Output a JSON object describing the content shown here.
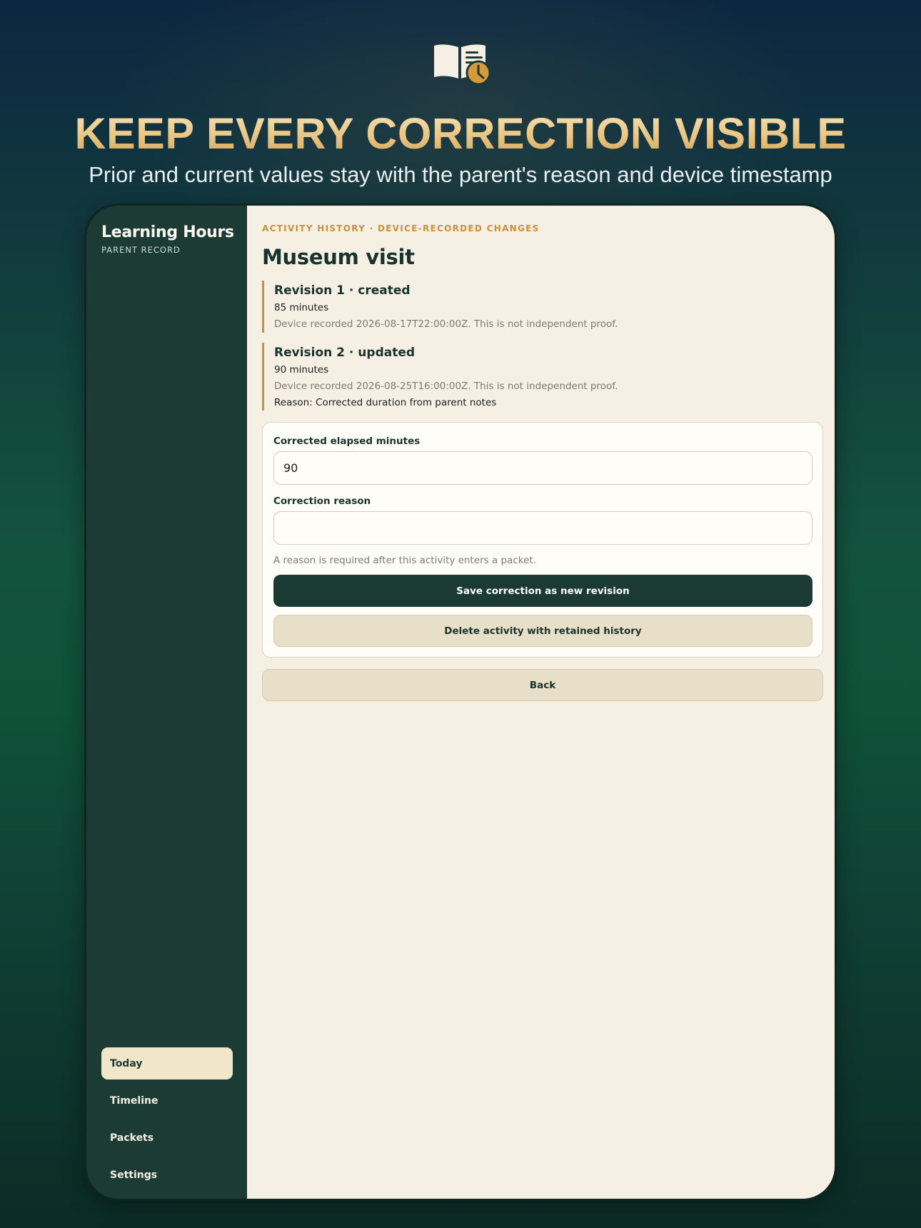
{
  "hero": {
    "icon": "book-clock-icon",
    "headline": "KEEP EVERY CORRECTION VISIBLE",
    "subhead": "Prior and current values stay with the parent's reason and device timestamp"
  },
  "colors": {
    "accent_gold": "#c9913a",
    "sidebar_bg": "#1b3b34",
    "main_bg": "#f6f0e4",
    "primary_button": "#1b3a34",
    "secondary_button": "#e8dfc8",
    "active_nav": "#f1e6ca"
  },
  "sidebar": {
    "title": "Learning Hours",
    "subtitle": "PARENT RECORD",
    "nav": [
      {
        "label": "Today",
        "active": true
      },
      {
        "label": "Timeline",
        "active": false
      },
      {
        "label": "Packets",
        "active": false
      },
      {
        "label": "Settings",
        "active": false
      }
    ]
  },
  "main": {
    "kicker": "ACTIVITY HISTORY · DEVICE-RECORDED CHANGES",
    "title": "Museum visit",
    "revisions": [
      {
        "title": "Revision 1 · created",
        "value": "85 minutes",
        "note": "Device recorded 2026-08-17T22:00:00Z. This is not independent proof."
      },
      {
        "title": "Revision 2 · updated",
        "value": "90 minutes",
        "note": "Device recorded 2026-08-25T16:00:00Z. This is not independent proof.",
        "reason": "Reason: Corrected duration from parent notes"
      }
    ],
    "form": {
      "minutes_label": "Corrected elapsed minutes",
      "minutes_value": "90",
      "reason_label": "Correction reason",
      "reason_value": "",
      "help": "A reason is required after this activity enters a packet.",
      "save_label": "Save correction as new revision",
      "delete_label": "Delete activity with retained history"
    },
    "back_label": "Back"
  }
}
